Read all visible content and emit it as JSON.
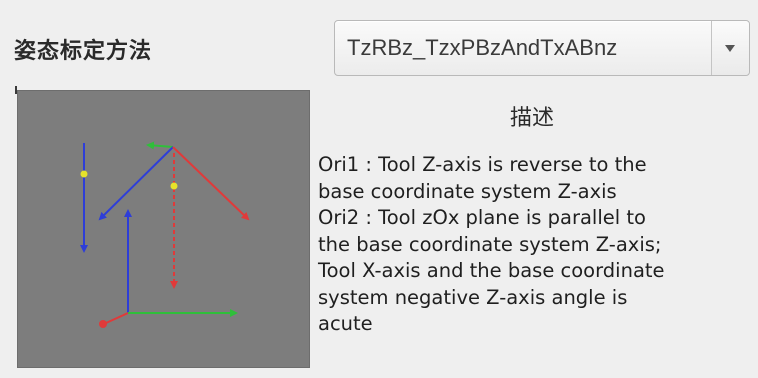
{
  "method": {
    "label": "姿态标定方法",
    "selected": "TzRBz_TzxPBzAndTxABnz"
  },
  "description": {
    "heading": "描述",
    "lines": [
      "Ori1 : Tool Z-axis is reverse to the",
      "base coordinate system Z-axis",
      "Ori2 : Tool zOx plane is parallel to",
      "the base coordinate system Z-axis;",
      "Tool X-axis and the base coordinate",
      "system negative Z-axis angle is",
      "acute"
    ]
  },
  "colors": {
    "preview_background": "#7d7d7d",
    "axis_x": "#e03a3a",
    "axis_y": "#2fbf3a",
    "axis_z": "#2e3ed8",
    "marker": "#e6e22a"
  },
  "icons": {
    "dropdown": "chevron-down-icon",
    "preview": "coordinate-axes-diagram"
  }
}
